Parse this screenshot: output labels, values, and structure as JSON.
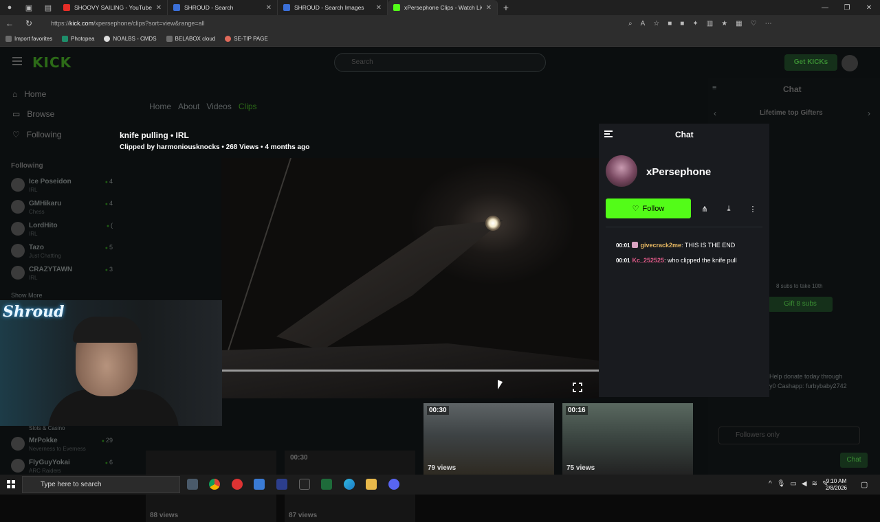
{
  "browser": {
    "tabs": [
      {
        "title": "SHOOVY SAILING - YouTube",
        "color": "#e52d27"
      },
      {
        "title": "SHROUD - Search",
        "color": "#3a6fd8"
      },
      {
        "title": "SHROUD - Search Images",
        "color": "#3a6fd8"
      },
      {
        "title": "xPersephone Clips - Watch Live c",
        "color": "#53fc18"
      }
    ],
    "url_prefix": "https://",
    "url_host": "kick.com",
    "url_path": "/xpersephone/clips?sort=view&range=all",
    "bookmarks": [
      "Import favorites",
      "Photopea",
      "NOALBS - CMDS",
      "BELABOX cloud",
      "SE-TIP PAGE"
    ]
  },
  "kick": {
    "logo": "KICK",
    "search_placeholder": "Search",
    "get_kicks": "Get KICKs",
    "nav": [
      "Home",
      "Browse",
      "Following"
    ],
    "following_header": "Following",
    "following": [
      {
        "name": "Ice Poseidon",
        "category": "IRL",
        "viewers": "4"
      },
      {
        "name": "GMHikaru",
        "category": "Chess",
        "viewers": "4"
      },
      {
        "name": "LordHito",
        "category": "IRL",
        "viewers": "("
      },
      {
        "name": "Tazo",
        "category": "Just Chatting",
        "viewers": "5"
      },
      {
        "name": "CRAZYTAWN",
        "category": "IRL",
        "viewers": "3"
      }
    ],
    "show_more": "Show More",
    "following_lower": [
      {
        "name": "MrPokke",
        "category": "Neverness to Everness",
        "viewers": "29"
      },
      {
        "name": "FlyGuyYokai",
        "category": "ARC Raiders",
        "viewers": "6"
      }
    ],
    "slots_label": "Slots & Casino",
    "channel_tabs": [
      "Home",
      "About",
      "Videos",
      "Clips"
    ],
    "right_panel": {
      "title": "Chat",
      "lifetime": "Lifetime top Gifters",
      "gift": "Gift 8 subs",
      "subs_note": "8 subs to take 10th",
      "donate": "Help donate today through",
      "cashapp": "y0 Cashapp: furbybaby2742",
      "followers_only": "Followers only",
      "chat_btn": "Chat"
    }
  },
  "clip": {
    "title": "knife pulling • IRL",
    "meta": "Clipped by harmoniousknocks • 268 Views • 4 months ago",
    "progress": 0
  },
  "chat_modal": {
    "title": "Chat",
    "channel": "xPersephone",
    "follow": "Follow",
    "messages": [
      {
        "time": "00:01",
        "user": "givecrack2me",
        "text": ": THIS IS THE END"
      },
      {
        "time": "00:01",
        "user": "Kc_252525",
        "text": ": who clipped the knife pull"
      }
    ]
  },
  "thumbs": [
    {
      "duration": "",
      "views": "88 views"
    },
    {
      "duration": "00:30",
      "views": "87 views"
    },
    {
      "duration": "00:30",
      "views": "79 views"
    },
    {
      "duration": "00:16",
      "views": "75 views"
    }
  ],
  "webcam_logo": "Shroud",
  "taskbar": {
    "search": "Type here to search",
    "time": "9:10 AM",
    "date": "2/8/2026"
  }
}
